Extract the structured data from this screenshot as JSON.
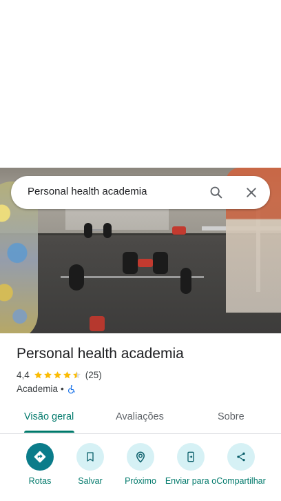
{
  "search": {
    "query": "Personal health academia"
  },
  "place": {
    "title": "Personal health academia",
    "rating": "4,4",
    "rating_value": 4.4,
    "review_count": "(25)",
    "category": "Academia",
    "separator": "•"
  },
  "tabs": [
    {
      "label": "Visão geral",
      "active": true
    },
    {
      "label": "Avaliações",
      "active": false
    },
    {
      "label": "Sobre",
      "active": false
    }
  ],
  "actions": [
    {
      "label": "Rotas",
      "icon": "directions-icon"
    },
    {
      "label": "Salvar",
      "icon": "bookmark-icon"
    },
    {
      "label": "Próximo",
      "icon": "nearby-icon"
    },
    {
      "label": "Enviar para o",
      "icon": "send-to-phone-icon"
    },
    {
      "label": "Compartilhar",
      "icon": "share-icon"
    }
  ],
  "colors": {
    "accent": "#00796b",
    "primary_button": "#0b7c8a",
    "star": "#fbbc04"
  }
}
